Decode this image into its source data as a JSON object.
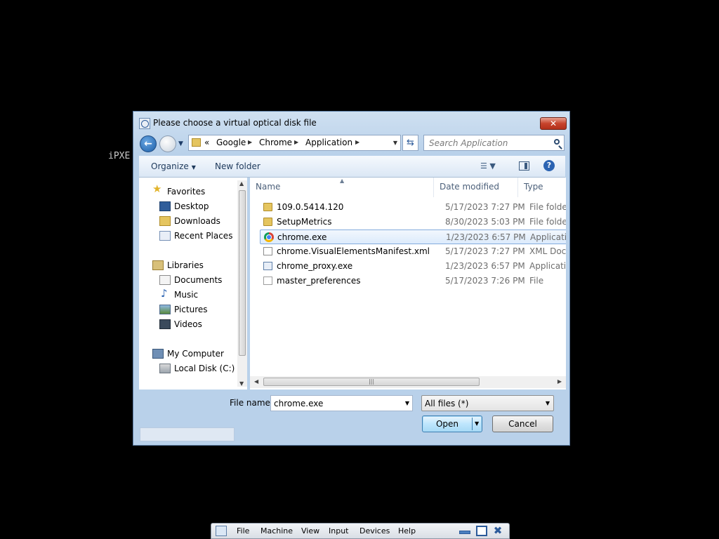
{
  "background_text": "iPXE",
  "dialog": {
    "title": "Please choose a virtual optical disk file",
    "close_symbol": "✕",
    "address": {
      "prefix": "«",
      "segments": [
        "Google",
        "Chrome",
        "Application"
      ]
    },
    "search_placeholder": "Search Application",
    "toolbar": {
      "organize": "Organize",
      "new_folder": "New folder"
    },
    "nav": {
      "favorites": "Favorites",
      "desktop": "Desktop",
      "downloads": "Downloads",
      "recent_places": "Recent Places",
      "libraries": "Libraries",
      "documents": "Documents",
      "music": "Music",
      "pictures": "Pictures",
      "videos": "Videos",
      "my_computer": "My Computer",
      "local_disk": "Local Disk (C:)"
    },
    "columns": {
      "name": "Name",
      "date": "Date modified",
      "type": "Type"
    },
    "files": [
      {
        "name": "109.0.5414.120",
        "date": "5/17/2023 7:27 PM",
        "type": "File folder",
        "icon": "folder-icon"
      },
      {
        "name": "SetupMetrics",
        "date": "8/30/2023 5:03 PM",
        "type": "File folder",
        "icon": "folder-icon"
      },
      {
        "name": "chrome.exe",
        "date": "1/23/2023 6:57 PM",
        "type": "Application",
        "icon": "chrome-icon",
        "selected": true
      },
      {
        "name": "chrome.VisualElementsManifest.xml",
        "date": "5/17/2023 7:27 PM",
        "type": "XML Docu",
        "icon": "xml-icon"
      },
      {
        "name": "chrome_proxy.exe",
        "date": "1/23/2023 6:57 PM",
        "type": "Application",
        "icon": "app-icon"
      },
      {
        "name": "master_preferences",
        "date": "5/17/2023 7:26 PM",
        "type": "File",
        "icon": "file-icon"
      }
    ],
    "file_name_label": "File name:",
    "file_name_value": "chrome.exe",
    "filter_value": "All files (*)",
    "open_label": "Open",
    "cancel_label": "Cancel"
  },
  "vbox_menu": {
    "items": [
      "File",
      "Machine",
      "View",
      "Input",
      "Devices",
      "Help"
    ]
  }
}
